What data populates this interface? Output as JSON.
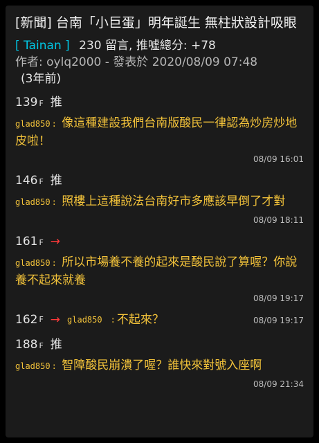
{
  "post": {
    "title": "[新聞] 台南「小巨蛋」明年誕生 無柱狀設計吸眼",
    "board": "[ Tainan ]",
    "stats": "230 留言, 推噓總分: +78",
    "author_line": "作者: oylq2000 - 發表於 2020/08/09 07:48",
    "age": "(3年前)"
  },
  "comments": [
    {
      "floor": "139",
      "floor_suffix": "F",
      "tag": "推",
      "user": "glad850",
      "sep": ":",
      "text": "像這種建設我們台南版酸民一律認為炒房炒地皮啦！",
      "time": "08/09 16:01"
    },
    {
      "floor": "146",
      "floor_suffix": "F",
      "tag": "推",
      "user": "glad850",
      "sep": ":",
      "text": "照樓上這種說法台南好市多應該早倒了才對",
      "time": "08/09 18:11"
    },
    {
      "floor": "161",
      "floor_suffix": "F",
      "tag": "→",
      "user": "glad850",
      "sep": ":",
      "text": "所以市場養不養的起來是酸民說了算喔？你說養不起來就養",
      "time": "08/09 19:17"
    },
    {
      "floor": "162",
      "floor_suffix": "F",
      "tag": "→",
      "user": "glad850",
      "sep": ":",
      "text": "不起來？",
      "time": "08/09 19:17"
    },
    {
      "floor": "188",
      "floor_suffix": "F",
      "tag": "推",
      "user": "glad850",
      "sep": ":",
      "text": "智障酸民崩潰了喔？誰快來對號入座啊",
      "time": "08/09 21:34"
    }
  ]
}
